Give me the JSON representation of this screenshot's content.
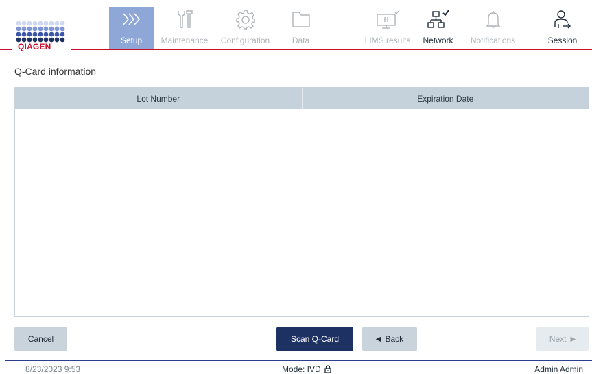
{
  "brand": {
    "logo_text": "QIAGEN",
    "accent": "#c8102e"
  },
  "nav": [
    {
      "key": "setup",
      "label": "Setup",
      "icon": "chevrons-right-icon",
      "state": "active"
    },
    {
      "key": "maintenance",
      "label": "Maintenance",
      "icon": "wrench-icon",
      "state": "disabled"
    },
    {
      "key": "configuration",
      "label": "Configuration",
      "icon": "gear-icon",
      "state": "disabled"
    },
    {
      "key": "data",
      "label": "Data",
      "icon": "folder-icon",
      "state": "disabled"
    },
    {
      "key": "lims",
      "label": "LIMS results",
      "icon": "monitor-check-icon",
      "state": "disabled"
    },
    {
      "key": "network",
      "label": "Network",
      "icon": "network-check-icon",
      "state": "enabled"
    },
    {
      "key": "notifications",
      "label": "Notifications",
      "icon": "bell-icon",
      "state": "disabled"
    },
    {
      "key": "session",
      "label": "Session",
      "icon": "user-logout-icon",
      "state": "enabled"
    }
  ],
  "page": {
    "title": "Q-Card information"
  },
  "table": {
    "columns": [
      "Lot Number",
      "Expiration Date"
    ],
    "rows": []
  },
  "buttons": {
    "cancel": "Cancel",
    "scan": "Scan Q-Card",
    "back": "Back",
    "next": "Next"
  },
  "footer": {
    "datetime": "8/23/2023 9:53",
    "mode": "Mode: IVD",
    "user": "Admin Admin"
  },
  "colors": {
    "primary_dark": "#1e3163",
    "active_nav": "#8fa7d6",
    "table_header": "#c5d2db"
  }
}
